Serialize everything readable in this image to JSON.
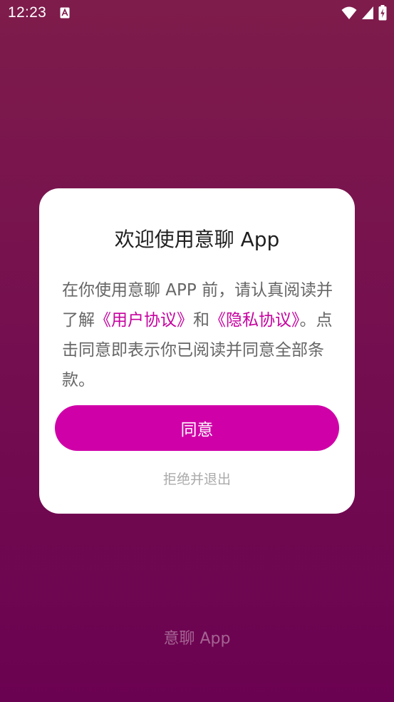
{
  "status_bar": {
    "time": "12:23",
    "icons": [
      "accessibility-a-icon",
      "wifi-icon",
      "cell-signal-icon",
      "battery-charging-icon"
    ]
  },
  "dialog": {
    "title": "欢迎使用意聊 App",
    "body": {
      "text_before_1": "在你使用意聊 APP 前，请认真阅读并了解",
      "link_user_agreement": "《用户协议》",
      "text_between": "和",
      "link_privacy": "《隐私协议》",
      "text_after": "。点击同意即表示你已阅读并同意全部条款。"
    },
    "agree_label": "同意",
    "reject_label": "拒绝并退出"
  },
  "footer": {
    "brand": "意聊 App"
  },
  "colors": {
    "accent": "#d000a8",
    "link": "#c6009f",
    "background_top": "#7e1c4b",
    "background_bottom": "#6b0251"
  }
}
